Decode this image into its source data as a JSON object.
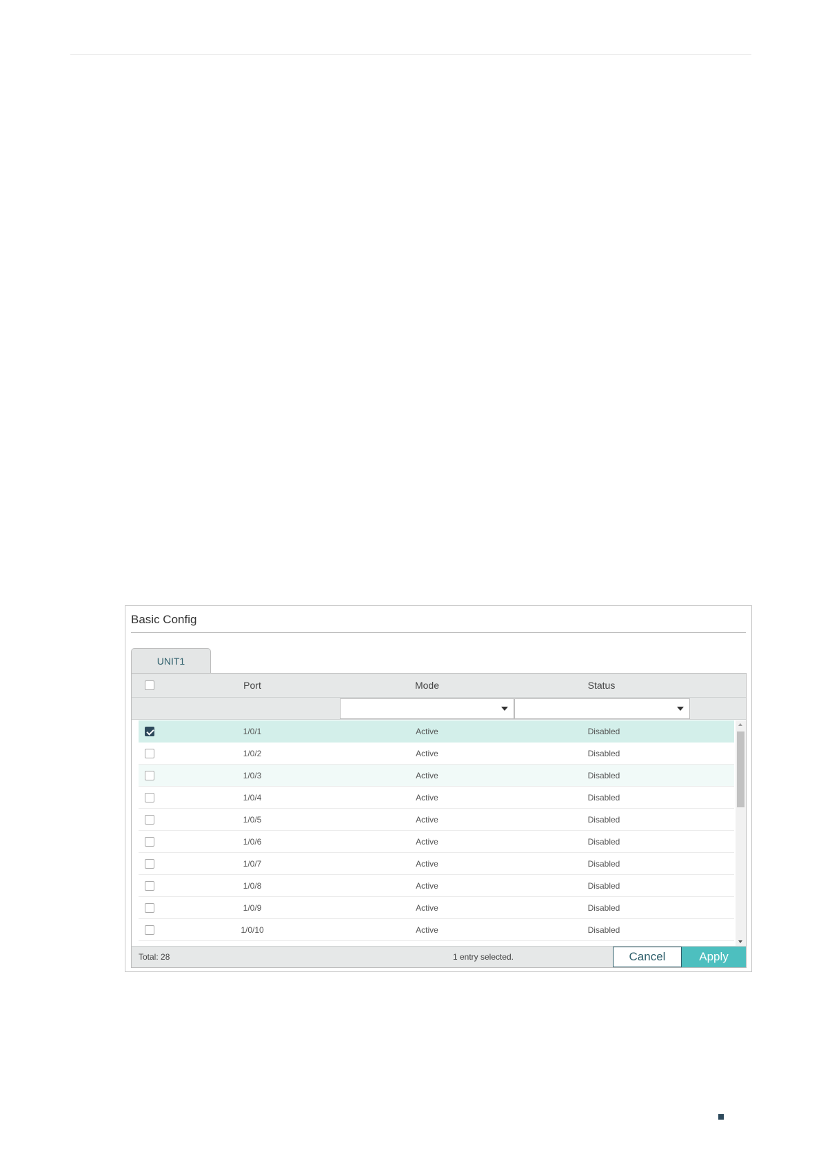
{
  "panel": {
    "title": "Basic Config",
    "tab_label": "UNIT1"
  },
  "table": {
    "columns": [
      "Port",
      "Mode",
      "Status"
    ],
    "filters": {
      "mode": "",
      "status": ""
    },
    "rows": [
      {
        "port": "1/0/1",
        "mode": "Active",
        "status": "Disabled",
        "checked": true
      },
      {
        "port": "1/0/2",
        "mode": "Active",
        "status": "Disabled",
        "checked": false
      },
      {
        "port": "1/0/3",
        "mode": "Active",
        "status": "Disabled",
        "checked": false
      },
      {
        "port": "1/0/4",
        "mode": "Active",
        "status": "Disabled",
        "checked": false
      },
      {
        "port": "1/0/5",
        "mode": "Active",
        "status": "Disabled",
        "checked": false
      },
      {
        "port": "1/0/6",
        "mode": "Active",
        "status": "Disabled",
        "checked": false
      },
      {
        "port": "1/0/7",
        "mode": "Active",
        "status": "Disabled",
        "checked": false
      },
      {
        "port": "1/0/8",
        "mode": "Active",
        "status": "Disabled",
        "checked": false
      },
      {
        "port": "1/0/9",
        "mode": "Active",
        "status": "Disabled",
        "checked": false
      },
      {
        "port": "1/0/10",
        "mode": "Active",
        "status": "Disabled",
        "checked": false
      }
    ]
  },
  "footer": {
    "total": "Total: 28",
    "selected": "1 entry selected.",
    "cancel_label": "Cancel",
    "apply_label": "Apply"
  },
  "colors": {
    "accent": "#4dbfbf",
    "selected_row": "#d3efea",
    "checkbox_checked": "#2e4a5c"
  }
}
